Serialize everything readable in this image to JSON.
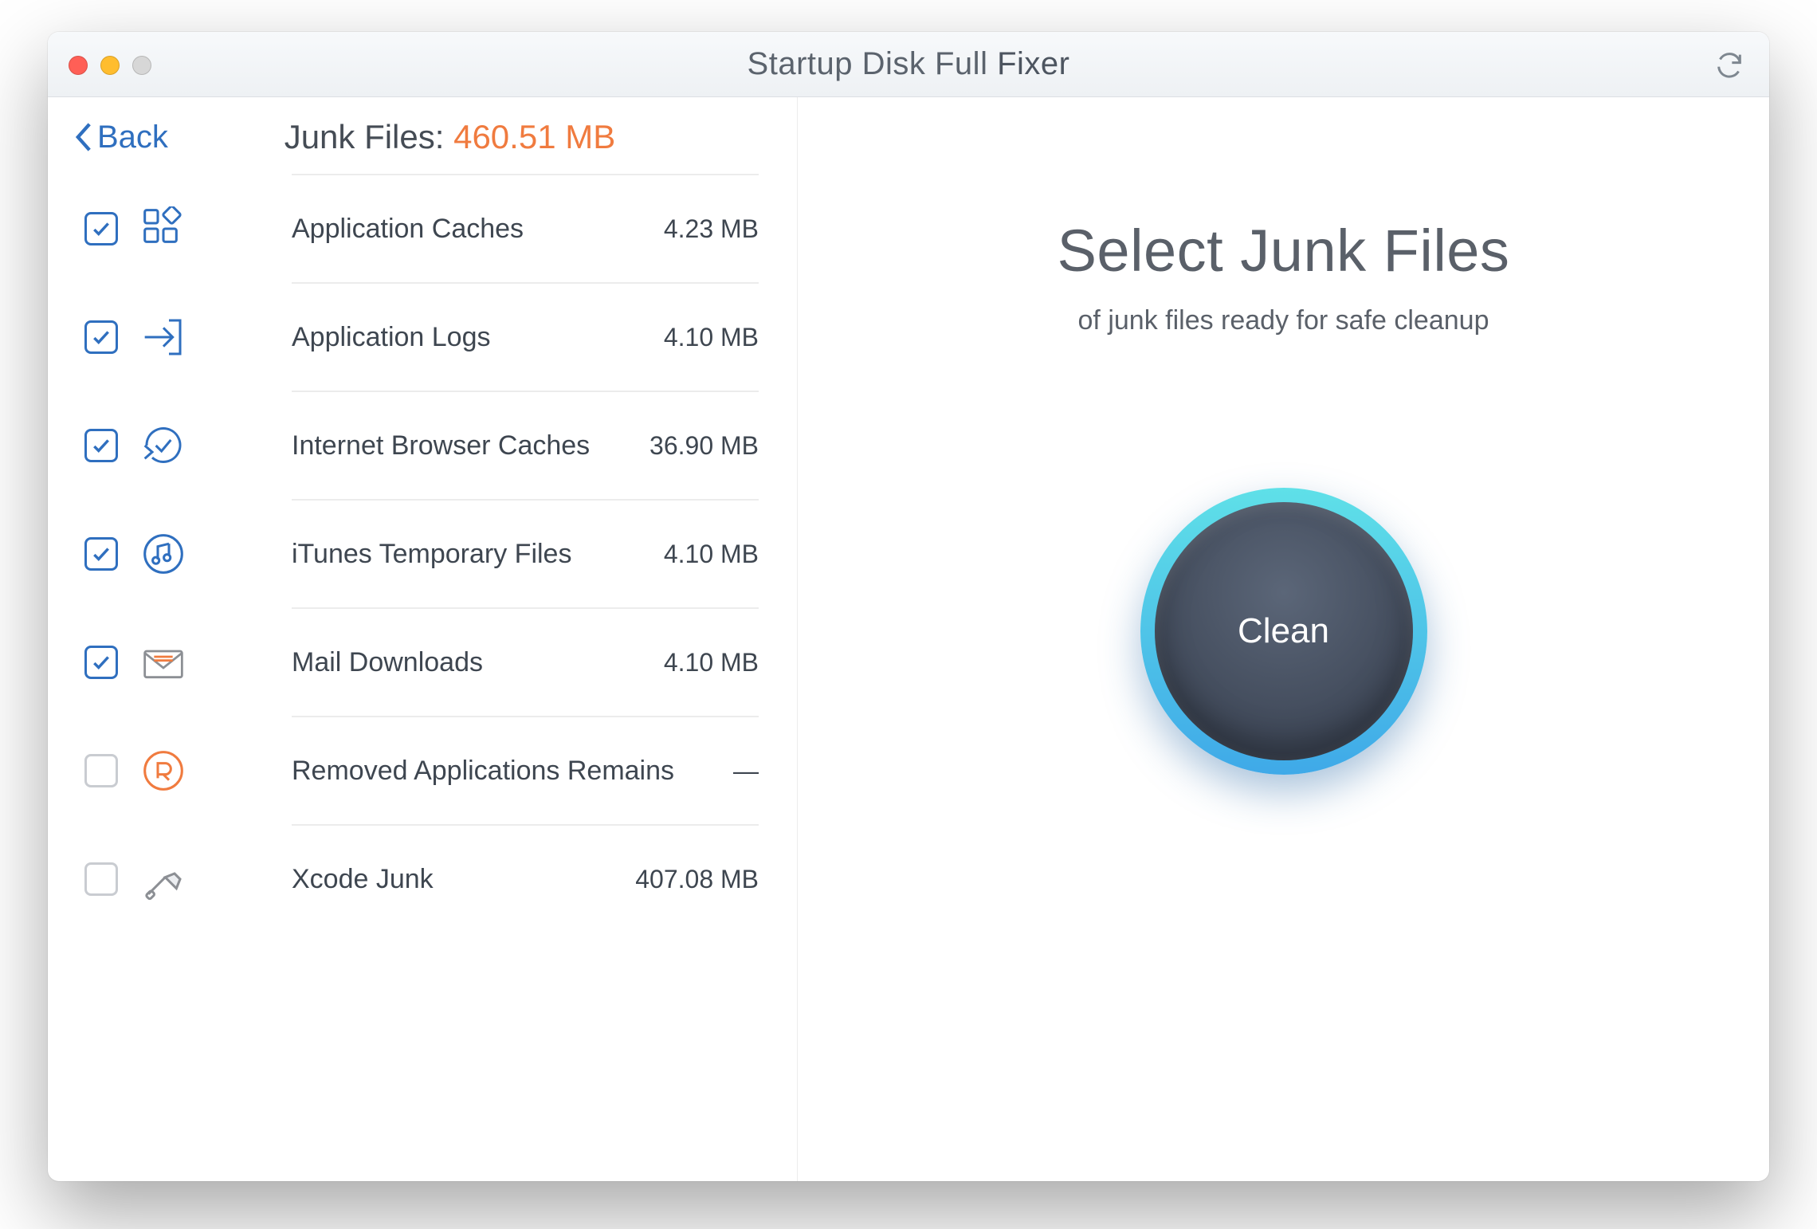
{
  "titlebar": {
    "title_prefix": "Startup Disk Full ",
    "title_bold": "Fixer"
  },
  "left": {
    "back_label": "Back",
    "junk_label": "Junk Files: ",
    "junk_size": "460.51 MB"
  },
  "items": [
    {
      "label": "Application Caches",
      "size": "4.23 MB",
      "checked": true,
      "icon": "grid"
    },
    {
      "label": "Application Logs",
      "size": "4.10 MB",
      "checked": true,
      "icon": "arrowin"
    },
    {
      "label": "Internet Browser Caches",
      "size": "36.90 MB",
      "checked": true,
      "icon": "refresh-check"
    },
    {
      "label": "iTunes Temporary Files",
      "size": "4.10 MB",
      "checked": true,
      "icon": "music"
    },
    {
      "label": "Mail Downloads",
      "size": "4.10 MB",
      "checked": true,
      "icon": "mail"
    },
    {
      "label": "Removed Applications Remains",
      "size": "—",
      "checked": false,
      "icon": "r-badge"
    },
    {
      "label": "Xcode Junk",
      "size": "407.08 MB",
      "checked": false,
      "icon": "hammer"
    }
  ],
  "right": {
    "heading": "Select Junk Files",
    "subtitle": "of junk files ready for safe cleanup",
    "clean_label": "Clean"
  }
}
